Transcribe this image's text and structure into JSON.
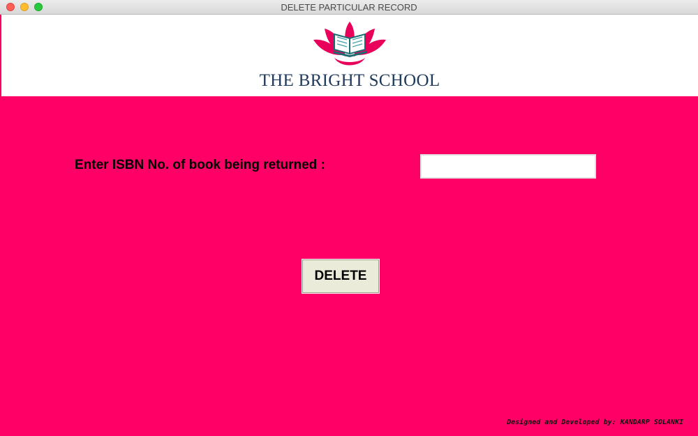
{
  "window": {
    "title": "DELETE PARTICULAR RECORD"
  },
  "header": {
    "school_name": "THE BRIGHT SCHOOL",
    "logo_icon": "lotus-book-logo"
  },
  "form": {
    "isbn_label": "Enter ISBN No. of book being returned :",
    "isbn_value": "",
    "isbn_placeholder": "",
    "delete_label": "DELETE"
  },
  "footer": {
    "credit": "Designed and Developed by: KANDARP SOLANKI"
  },
  "colors": {
    "background": "#ff0066",
    "header_bg": "#ffffff",
    "school_name": "#1e3a5c",
    "button_bg": "#ebebd9"
  }
}
